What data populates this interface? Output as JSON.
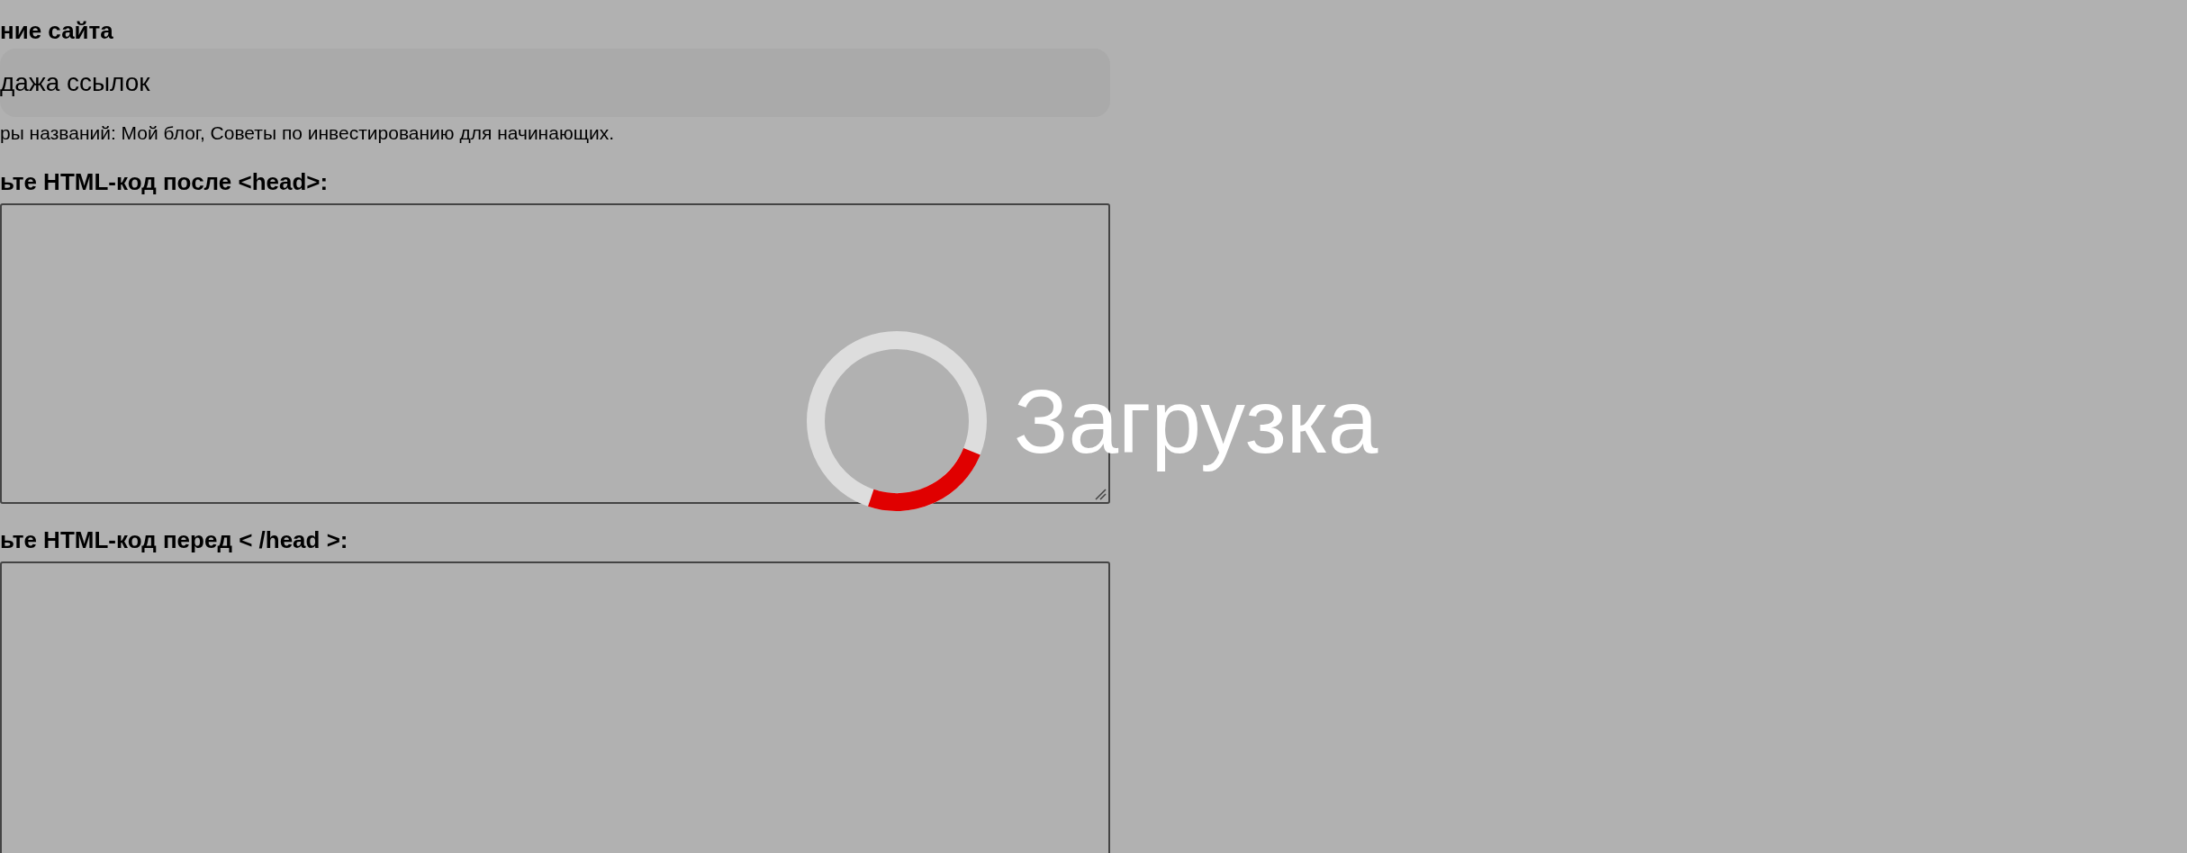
{
  "form": {
    "fields": [
      {
        "kind": "input",
        "label": "ние сайта",
        "value": "дажа ссылок",
        "hint": "ры названий: Мой блог, Советы по инвестированию для начинающих."
      },
      {
        "kind": "textarea",
        "label": "ьте HTML-код после <head>:"
      },
      {
        "kind": "textarea",
        "label": "ьте HTML-код перед < /head >:"
      }
    ]
  },
  "loading_overlay": {
    "text": "Загрузка"
  }
}
